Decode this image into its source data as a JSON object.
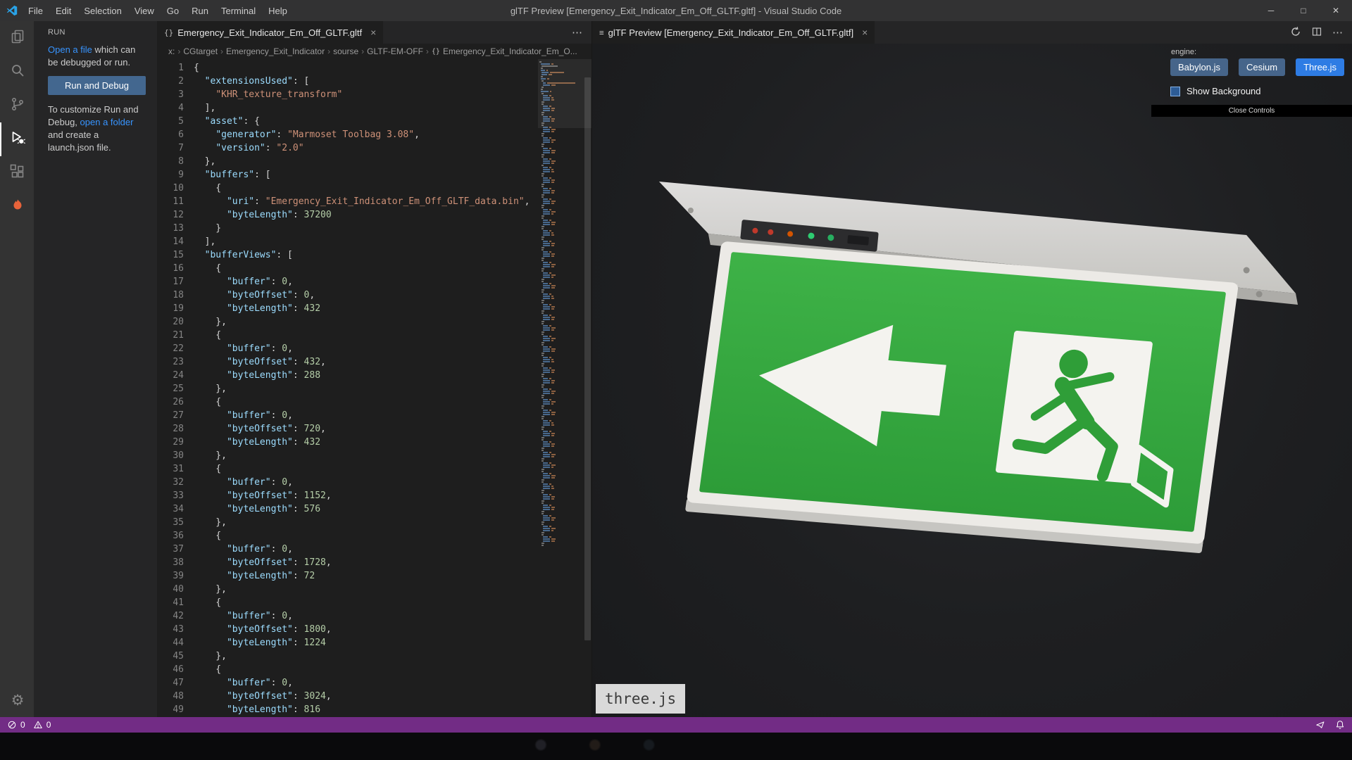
{
  "colors": {
    "title-bar-bg": "#323233",
    "activity-bar-bg": "#333333",
    "tab-bar-bg": "#252526",
    "editor-bg": "#1e1e1e",
    "statusbar-purple": "#722c85",
    "link-blue": "#3794ff",
    "run-button-blue": "#43678f",
    "engine-button-blue": "#46658a",
    "engine-active-blue": "#2e7ce4",
    "sign-green": "#36a93f"
  },
  "icons": {
    "gear": "⚙",
    "chevron": "›",
    "json_braces": "{}",
    "ellipsis": "⋯",
    "tab_close": "×",
    "preview_tab": "≡",
    "minimize": "─",
    "maximize": "□",
    "window_close": "✕"
  },
  "window": {
    "title": "glTF Preview [Emergency_Exit_Indicator_Em_Off_GLTF.gltf] - Visual Studio Code",
    "menus": [
      "File",
      "Edit",
      "Selection",
      "View",
      "Go",
      "Run",
      "Terminal",
      "Help"
    ]
  },
  "run_panel": {
    "title": "RUN",
    "open_file_link": "Open a file",
    "open_file_rest": " which can be debugged or run.",
    "run_button": "Run and Debug",
    "customize_pre": "To customize Run and Debug, ",
    "open_folder_link": "open a folder",
    "customize_post": " and create a launch.json file."
  },
  "editor": {
    "tab_label": "Emergency_Exit_Indicator_Em_Off_GLTF.gltf",
    "breadcrumbs": [
      "x:",
      "CGtarget",
      "Emergency_Exit_Indicator",
      "sourse",
      "GLTF-EM-OFF",
      "Emergency_Exit_Indicator_Em_O..."
    ],
    "code_lines": [
      "{",
      "  \"extensionsUsed\": [",
      "    \"KHR_texture_transform\"",
      "  ],",
      "  \"asset\": {",
      "    \"generator\": \"Marmoset Toolbag 3.08\",",
      "    \"version\": \"2.0\"",
      "  },",
      "  \"buffers\": [",
      "    {",
      "      \"uri\": \"Emergency_Exit_Indicator_Em_Off_GLTF_data.bin\",",
      "      \"byteLength\": 37200",
      "    }",
      "  ],",
      "  \"bufferViews\": [",
      "    {",
      "      \"buffer\": 0,",
      "      \"byteOffset\": 0,",
      "      \"byteLength\": 432",
      "    },",
      "    {",
      "      \"buffer\": 0,",
      "      \"byteOffset\": 432,",
      "      \"byteLength\": 288",
      "    },",
      "    {",
      "      \"buffer\": 0,",
      "      \"byteOffset\": 720,",
      "      \"byteLength\": 432",
      "    },",
      "    {",
      "      \"buffer\": 0,",
      "      \"byteOffset\": 1152,",
      "      \"byteLength\": 576",
      "    },",
      "    {",
      "      \"buffer\": 0,",
      "      \"byteOffset\": 1728,",
      "      \"byteLength\": 72",
      "    },",
      "    {",
      "      \"buffer\": 0,",
      "      \"byteOffset\": 1800,",
      "      \"byteLength\": 1224",
      "    },",
      "    {",
      "      \"buffer\": 0,",
      "      \"byteOffset\": 3024,",
      "      \"byteLength\": 816"
    ]
  },
  "preview": {
    "tab_label": "glTF Preview [Emergency_Exit_Indicator_Em_Off_GLTF.gltf]",
    "engine_label": "engine:",
    "engines": [
      "Babylon.js",
      "Cesium",
      "Three.js"
    ],
    "active_engine": "Three.js",
    "show_background_label": "Show Background",
    "close_controls_label": "Close Controls",
    "watermark": "three.js"
  },
  "status_bar": {
    "errors": "0",
    "warnings": "0"
  }
}
